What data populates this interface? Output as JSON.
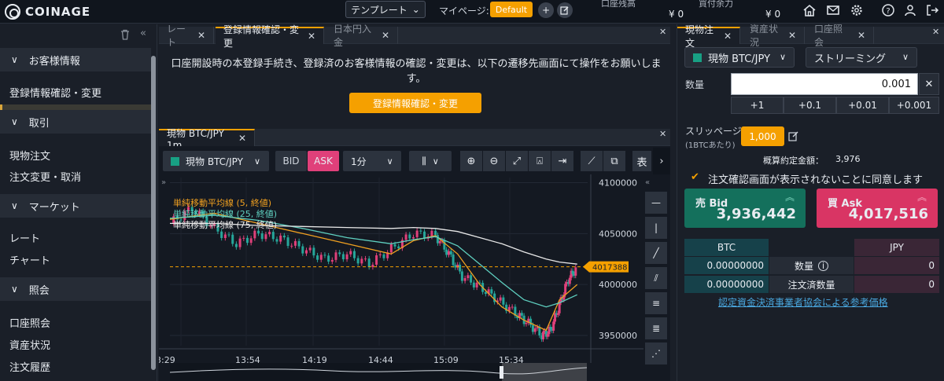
{
  "header": {
    "brand": "COINAGE",
    "template_label": "テンプレート",
    "mypage_label": "マイページ:",
    "mypage_value": "Default",
    "plus": "+",
    "balance_label": "口座残高",
    "balance_value": "¥ 0",
    "buying_power_label": "買付余力",
    "buying_power_value": "¥ 0",
    "icons": [
      "home-icon",
      "mail-icon",
      "gear-icon",
      "help-icon",
      "user-icon",
      "logout-icon"
    ]
  },
  "sidebar": {
    "sections": [
      {
        "title": "お客様情報",
        "items": [
          "登録情報確認・変更"
        ]
      },
      {
        "title": "取引",
        "items": [
          "現物注文",
          "注文変更・取消"
        ]
      },
      {
        "title": "マーケット",
        "items": [
          "レート",
          "チャート"
        ]
      },
      {
        "title": "照会",
        "items": [
          "口座照会",
          "資産状況",
          "注文履歴"
        ]
      }
    ]
  },
  "center_tabs": [
    "レート",
    "登録情報確認・変更",
    "日本円入金"
  ],
  "notice": {
    "text": "口座開設時の本登録手続き、登録済のお客様情報の確認・変更は、以下の遷移先画面にて操作をお願いします。",
    "button": "登録情報確認・変更"
  },
  "chart_tab": "現物 BTC/JPY 1m",
  "chart_toolbar": {
    "pair": "現物 BTC/JPY",
    "bid": "BID",
    "ask": "ASK",
    "interval": "1分",
    "table_btn": "表"
  },
  "chart_data": {
    "type": "line",
    "title": "",
    "legend": [
      "単純移動平均線 (5, 終値)",
      "単純移動平均線 (25, 終値)",
      "単純移動平均線 (75, 終値)"
    ],
    "x_ticks": [
      "13:29",
      "13:54",
      "14:19",
      "14:44",
      "15:09",
      "15:34"
    ],
    "y_ticks": [
      4100000,
      4050000,
      4000000,
      3950000
    ],
    "ylim": [
      3940000,
      4105000
    ],
    "current_price": 4017388,
    "colors": {
      "ma5": "#f0a020",
      "ma25": "#5fd0c0",
      "ma75": "#e8e8e8",
      "up": "#e0407a",
      "down": "#26a69a"
    },
    "series": [
      {
        "name": "単純移動平均線 (5, 終値)",
        "x": [
          0,
          10,
          20,
          30,
          40,
          50,
          55,
          60,
          65,
          70,
          75,
          80,
          85,
          88,
          92
        ],
        "values": [
          4064000,
          4070000,
          4060000,
          4050000,
          4040000,
          4030000,
          4043000,
          4048000,
          4030000,
          4000000,
          3978000,
          3965000,
          3955000,
          3985000,
          4000000
        ]
      },
      {
        "name": "単純移動平均線 (25, 終値)",
        "x": [
          0,
          10,
          20,
          30,
          40,
          50,
          55,
          60,
          65,
          70,
          75,
          80,
          85,
          88,
          92
        ],
        "values": [
          4065000,
          4068000,
          4063000,
          4055000,
          4046000,
          4040000,
          4044000,
          4047000,
          4038000,
          4020000,
          4002000,
          3985000,
          3978000,
          3982000,
          3990000
        ]
      },
      {
        "name": "単純移動平均線 (75, 終値)",
        "x": [
          0,
          10,
          20,
          30,
          40,
          50,
          55,
          60,
          65,
          70,
          75,
          80,
          85,
          88,
          92
        ],
        "values": [
          4060000,
          4060000,
          4058000,
          4057000,
          4056000,
          4055000,
          4056000,
          4055000,
          4052000,
          4046000,
          4040000,
          4032000,
          4025000,
          4022000,
          4020000
        ]
      },
      {
        "name": "close",
        "x": [
          0,
          5,
          10,
          15,
          20,
          25,
          30,
          35,
          40,
          45,
          50,
          55,
          60,
          63,
          66,
          70,
          74,
          78,
          81,
          84,
          86,
          88,
          90,
          92
        ],
        "values": [
          4060000,
          4075000,
          4055000,
          4040000,
          4050000,
          4045000,
          4035000,
          4025000,
          4030000,
          4020000,
          4035000,
          4050000,
          4048000,
          4030000,
          4008000,
          3998000,
          3985000,
          3972000,
          3962000,
          3950000,
          3955000,
          3980000,
          4005000,
          4017000
        ]
      }
    ]
  },
  "right_tabs": [
    "現物注文",
    "資産状況",
    "口座照会"
  ],
  "order": {
    "pair": "現物 BTC/JPY",
    "mode": "ストリーミング",
    "qty_label": "数量",
    "qty_value": "0.001",
    "steps": [
      "+1",
      "+0.1",
      "+0.01",
      "+0.001"
    ],
    "slippage_label": "スリッページ",
    "slippage_sub": "(1BTCあたり)",
    "slippage_value": "1,000",
    "estimate_label": "概算約定金額：",
    "estimate_value": "3,976",
    "agree_label": "注文確認画面が表示されないことに同意します",
    "sell_label": "売 Bid",
    "sell_value": "3,936,442",
    "buy_label": "買 Ask",
    "buy_value": "4,017,516",
    "table_head_btc": "BTC",
    "table_head_jpy": "JPY",
    "row1_label": "数量",
    "row1_btc": "0.00000000",
    "row1_jpy": "0",
    "row2_label": "注文済数量",
    "row2_btc": "0.00000000",
    "row2_jpy": "0",
    "link": "認定資金決済事業者協会による参考価格"
  }
}
